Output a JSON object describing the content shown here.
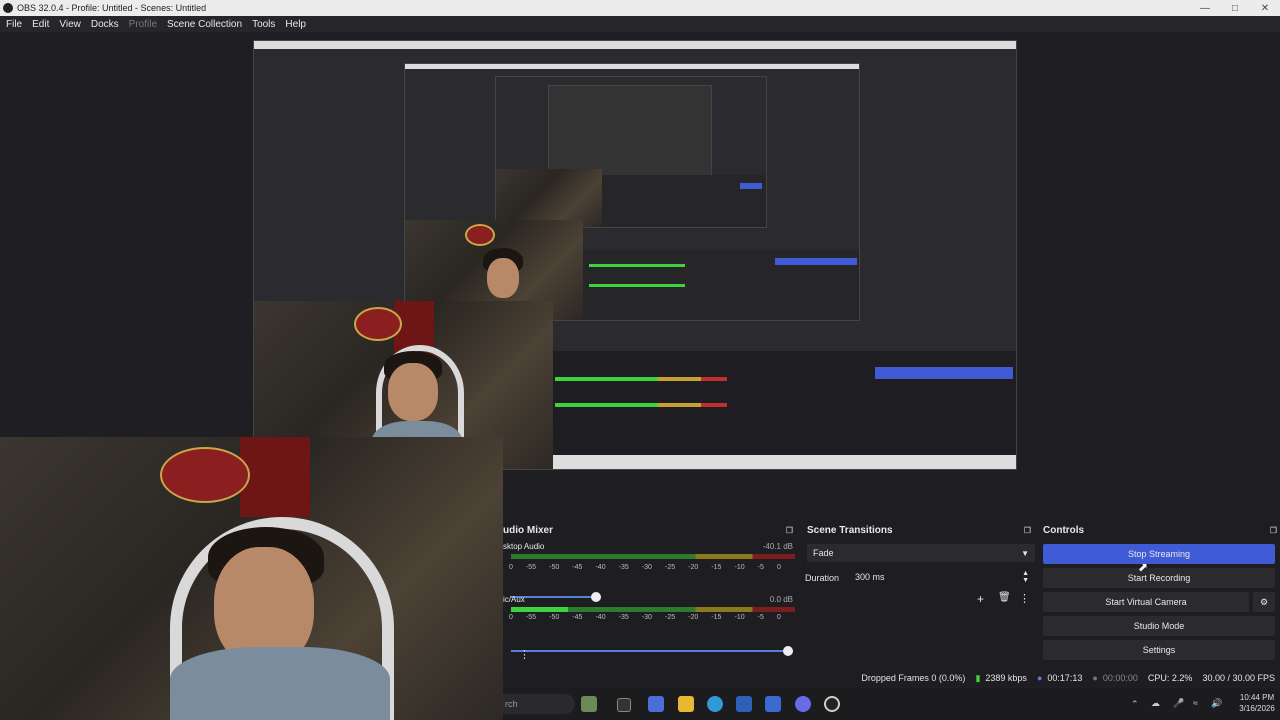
{
  "window": {
    "title": "OBS 32.0.4 - Profile: Untitled - Scenes: Untitled"
  },
  "menu": [
    "File",
    "Edit",
    "View",
    "Docks",
    "Profile",
    "Scene Collection",
    "Tools",
    "Help"
  ],
  "audio_mixer": {
    "title": "udio Mixer",
    "channels": [
      {
        "name": "sktop Audio",
        "db": "-40.1 dB"
      },
      {
        "name": "ic/Aux",
        "db": "0.0 dB"
      }
    ],
    "scale": [
      "0",
      "-55",
      "-50",
      "-45",
      "-40",
      "-35",
      "-30",
      "-25",
      "-20",
      "-15",
      "-10",
      "-5",
      "0"
    ]
  },
  "scene_transitions": {
    "title": "Scene Transitions",
    "transition": "Fade",
    "duration_label": "Duration",
    "duration_value": "300 ms"
  },
  "controls": {
    "title": "Controls",
    "buttons": [
      "Stop Streaming",
      "Start Recording",
      "Start Virtual Camera",
      "Studio Mode",
      "Settings"
    ]
  },
  "status": {
    "dropped_frames": "Dropped Frames 0 (0.0%)",
    "bitrate": "2389 kbps",
    "stream_time": "00:17:13",
    "record_time": "00:00:00",
    "cpu": "CPU: 2.2%",
    "fps": "30.00 / 30.00 FPS"
  },
  "taskbar": {
    "search": "rch",
    "time": "10:44 PM",
    "date": "3/16/2026"
  }
}
